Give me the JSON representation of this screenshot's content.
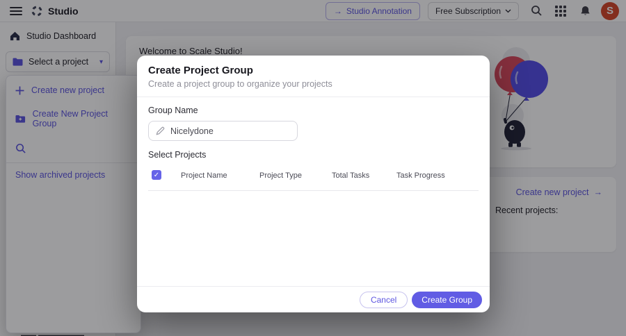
{
  "topbar": {
    "product_name": "Studio",
    "annotation_button_label": "Studio Annotation",
    "annotation_arrow": "→",
    "subscription_button_label": "Free Subscription",
    "avatar_letter": "S"
  },
  "sidebar": {
    "dashboard_label": "Studio Dashboard",
    "project_selector_label": "Select a project",
    "selector_caret": "▾",
    "dropdown": {
      "create_project_label": "Create new project",
      "create_group_label": "Create New Project Group",
      "show_archived_label": "Show archived projects"
    }
  },
  "main": {
    "welcome_title": "Welcome to Scale Studio!",
    "create_project_link": "Create new project",
    "create_project_arrow": "→",
    "recent_projects_label": "Recent projects:"
  },
  "modal": {
    "title": "Create Project Group",
    "subtitle": "Create a project group to organize your projects",
    "group_name_label": "Group Name",
    "group_name_value": "Nicelydone",
    "select_projects_label": "Select Projects",
    "checkbox_state": "checked",
    "checkmark": "✓",
    "table_headers": [
      "Project Name",
      "Project Type",
      "Total Tasks",
      "Task Progress"
    ],
    "cancel_label": "Cancel",
    "create_label": "Create Group"
  },
  "colors": {
    "accent": "#5D55E0",
    "create_button_fill": "#615CE4",
    "checkbox_fill": "#6663E8",
    "avatar_background": "#D6492A",
    "balloon_red": "#D94A5E",
    "balloon_blue": "#554FE8",
    "overlay": "rgba(8,8,12,0.40)"
  }
}
